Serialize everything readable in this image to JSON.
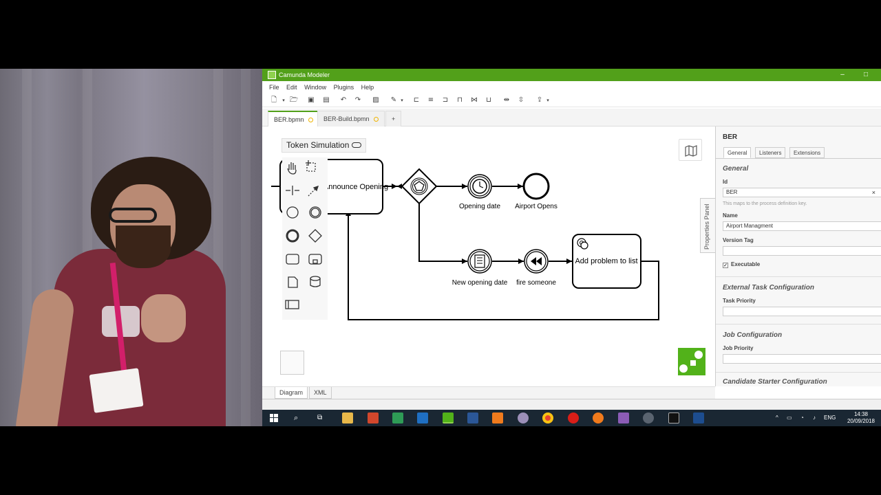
{
  "window": {
    "title": "Camunda Modeler",
    "menu": [
      "File",
      "Edit",
      "Window",
      "Plugins",
      "Help"
    ]
  },
  "tabs": [
    {
      "label": "BER.bpmn",
      "active": true,
      "unsaved": true
    },
    {
      "label": "BER-Build.bpmn",
      "active": false,
      "unsaved": true
    },
    {
      "label": "+",
      "active": false
    }
  ],
  "canvas": {
    "token_simulation_label": "Token Simulation",
    "nodes": {
      "announce_task": "Announce Opening",
      "timer_event": "Opening date",
      "end_event": "Airport Opens",
      "message_event": "New opening date",
      "throw_event": "fire someone",
      "service_task": "Add problem to list"
    }
  },
  "bottom_tabs": [
    "Diagram",
    "XML"
  ],
  "properties": {
    "panel_label": "Properties Panel",
    "element_title": "BER",
    "tabs": [
      "General",
      "Listeners",
      "Extensions"
    ],
    "general_section": "General",
    "id_label": "Id",
    "id_value": "BER",
    "id_hint": "This maps to the process definition key.",
    "name_label": "Name",
    "name_value": "Airport Managment",
    "version_tag_label": "Version Tag",
    "executable_label": "Executable",
    "external_task_section": "External Task Configuration",
    "task_priority_label": "Task Priority",
    "job_section": "Job Configuration",
    "job_priority_label": "Job Priority",
    "candidate_section": "Candidate Starter Configuration"
  },
  "taskbar": {
    "language": "ENG",
    "time": "14:38",
    "date": "20/09/2018"
  },
  "colors": {
    "camunda_green": "#52a01a",
    "taskbar": "#1a2733"
  }
}
